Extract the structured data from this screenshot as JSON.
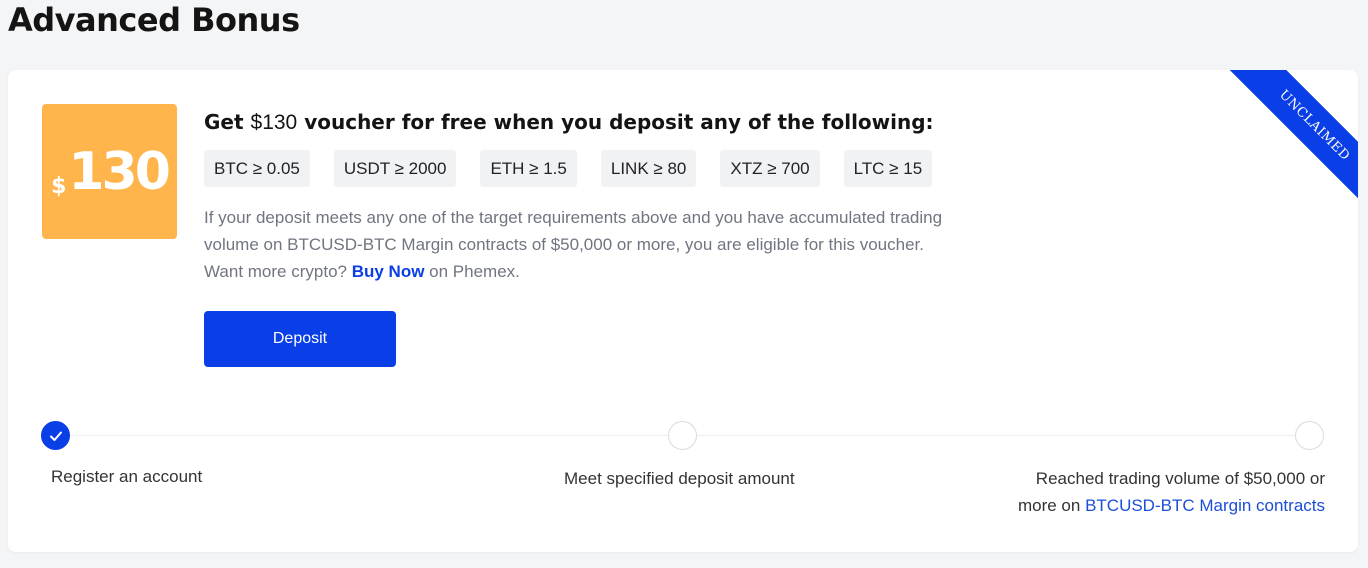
{
  "page": {
    "title": "Advanced Bonus"
  },
  "voucher": {
    "currency": "$",
    "amount": "130",
    "status": "UNCLAIMED",
    "headline_prefix": "Get ",
    "headline_amount": "$130",
    "headline_suffix": " voucher for free when you deposit any of the following:"
  },
  "requirements": [
    {
      "label": "BTC ≥ 0.05"
    },
    {
      "label": "USDT ≥ 2000"
    },
    {
      "label": "ETH ≥ 1.5"
    },
    {
      "label": "LINK ≥ 80"
    },
    {
      "label": "XTZ ≥ 700"
    },
    {
      "label": "LTC ≥ 15"
    }
  ],
  "description": {
    "text": "If your deposit meets any one of the target requirements above and you have accumulated trading volume on BTCUSD-BTC Margin contracts of $50,000 or more, you are eligible for this voucher. Want more crypto? ",
    "link_label": "Buy Now",
    "suffix": " on Phemex."
  },
  "actions": {
    "deposit_label": "Deposit"
  },
  "steps": [
    {
      "label": "Register an account",
      "completed": true
    },
    {
      "label": "Meet specified deposit amount",
      "completed": false
    },
    {
      "label_line1": "Reached trading volume of $50,000 or",
      "label_prefix": "more on ",
      "link_label": "BTCUSD-BTC Margin contracts",
      "completed": false
    }
  ],
  "colors": {
    "accent": "#0a3ee6",
    "voucher_bg": "#ffb54c",
    "chip_bg": "#f1f2f4"
  }
}
